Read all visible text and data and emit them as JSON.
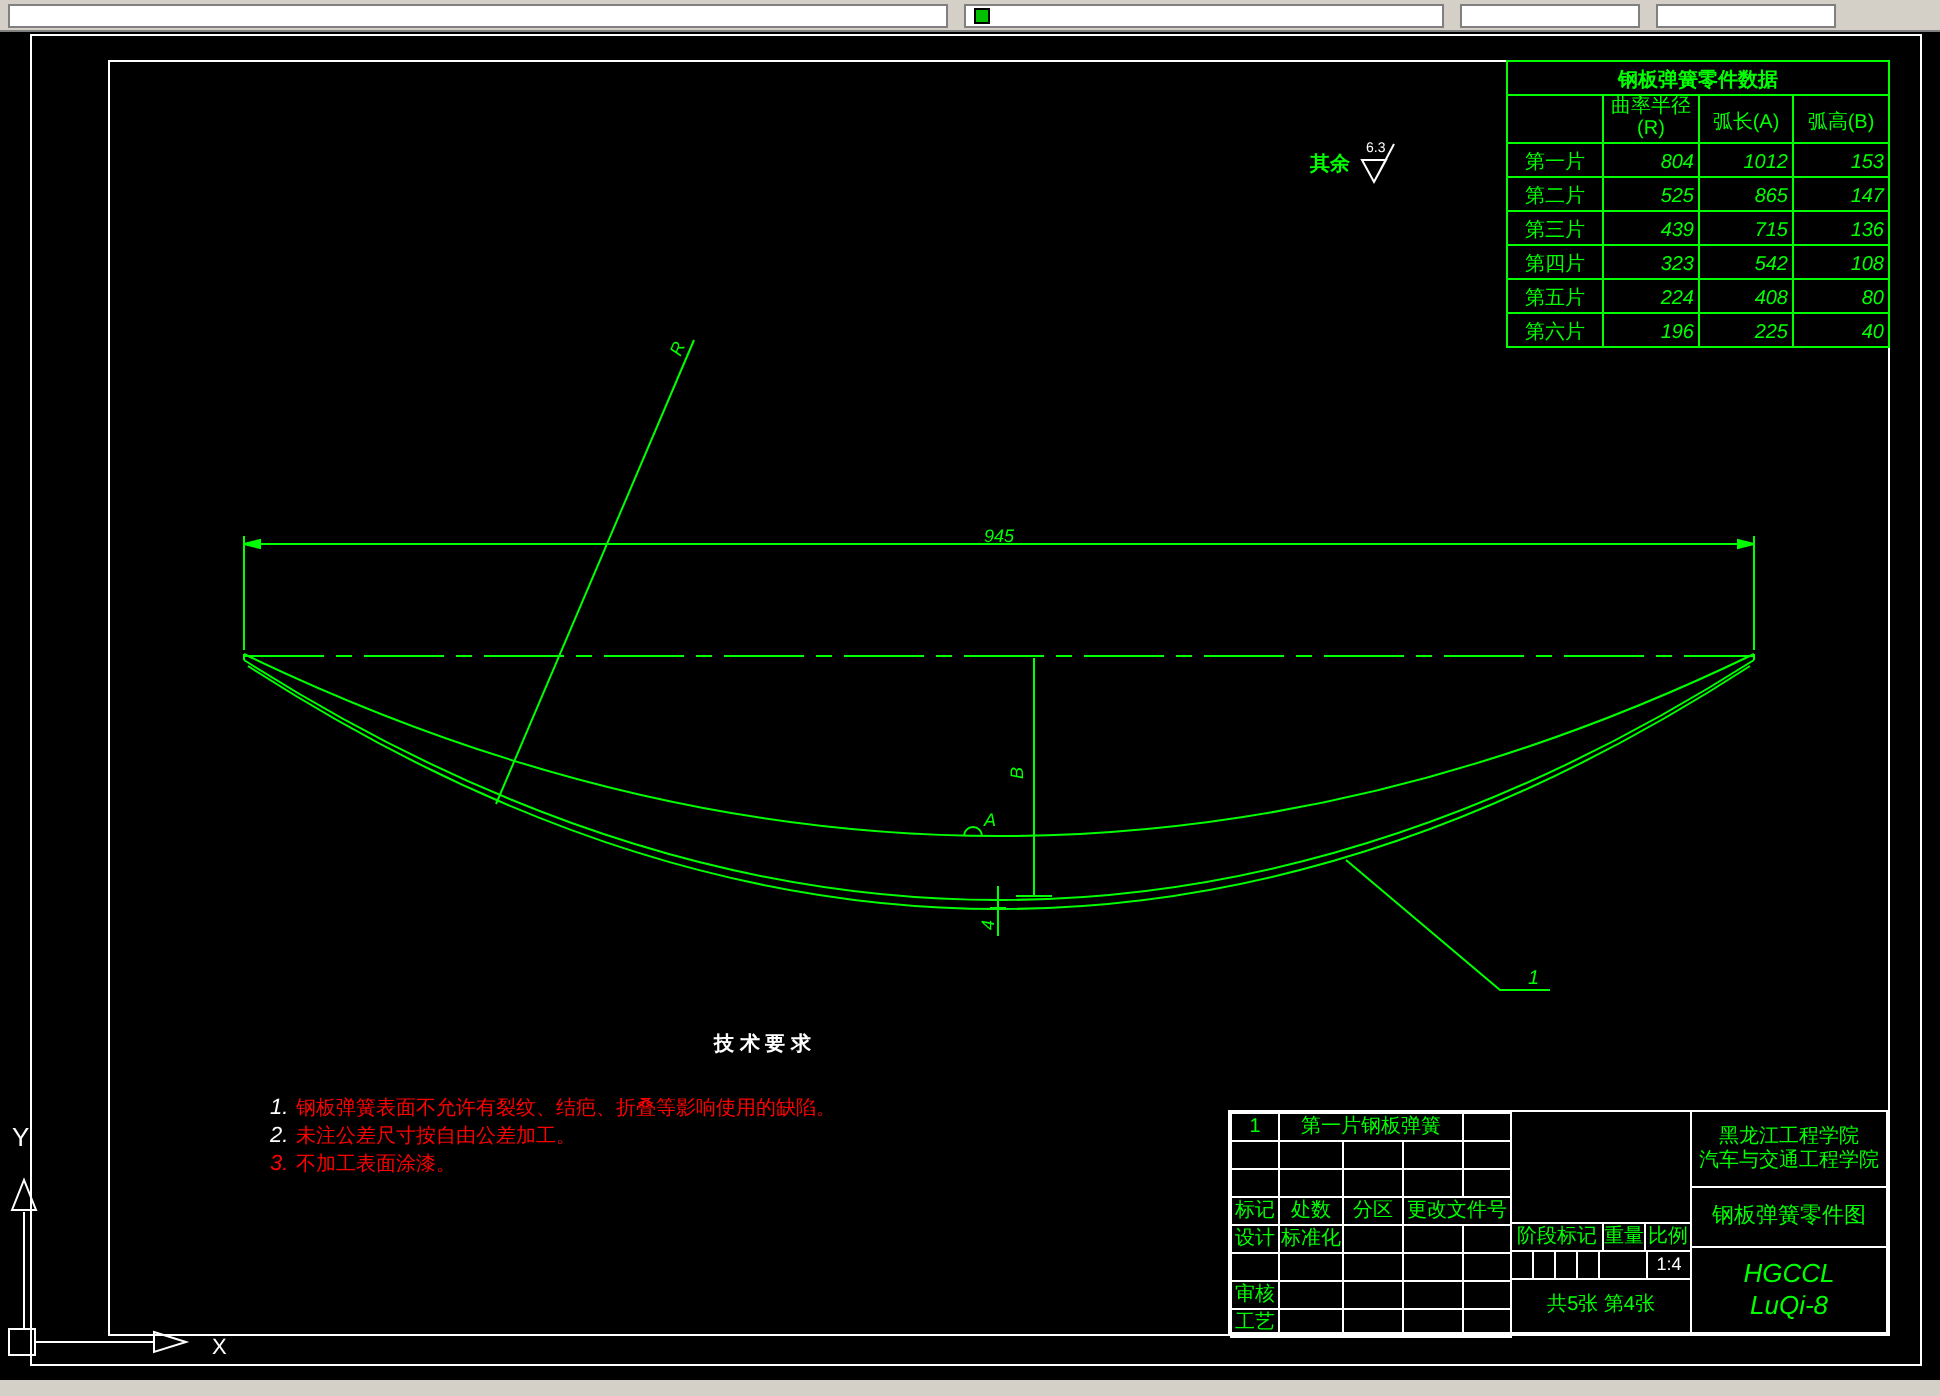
{
  "drawing": {
    "roughness_note": {
      "label": "其余",
      "value": "6.3"
    },
    "dimensions": {
      "span": "945",
      "radius": "R",
      "height": "B",
      "arc": "A",
      "thickness": "4",
      "part_number": "1"
    },
    "leaf_table": {
      "title": "钢板弹簧零件数据",
      "columns": [
        "曲率半径(R)",
        "弧长(A)",
        "弧高(B)"
      ],
      "rows": [
        {
          "name": "第一片",
          "values": [
            "804",
            "1012",
            "153"
          ]
        },
        {
          "name": "第二片",
          "values": [
            "525",
            "865",
            "147"
          ]
        },
        {
          "name": "第三片",
          "values": [
            "439",
            "715",
            "136"
          ]
        },
        {
          "name": "第四片",
          "values": [
            "323",
            "542",
            "108"
          ]
        },
        {
          "name": "第五片",
          "values": [
            "224",
            "408",
            "80"
          ]
        },
        {
          "name": "第六片",
          "values": [
            "196",
            "225",
            "40"
          ]
        }
      ]
    },
    "tech_requirements": {
      "title": "技 术 要 求",
      "items": [
        {
          "number": "1.",
          "text": "钢板弹簧表面不允许有裂纹、结疤、折叠等影响使用的缺陷。",
          "color": "#ffffff"
        },
        {
          "number": "2.",
          "text": "未注公差尺寸按自由公差加工。",
          "color": "#ffffff"
        },
        {
          "number": "3.",
          "text": "不加工表面涂漆。",
          "color": "#ff0000"
        }
      ]
    },
    "title_block": {
      "sheet_item": "1",
      "part_name": "第一片钢板弹簧",
      "revision_labels": [
        "标记",
        "处数",
        "分区",
        "更改文件号"
      ],
      "signature_labels": [
        "设计",
        "标准化"
      ],
      "review_label": "审核",
      "process_label": "工艺",
      "stage_labels": [
        "阶段标记",
        "重量",
        "比例"
      ],
      "scale": "1:4",
      "sheet_count": "共5张 第4张",
      "school": [
        "黑龙江工程学院",
        "汽车与交通工程学院"
      ],
      "drawing_title": "钢板弹簧零件图",
      "drawing_code": [
        "HGCCL",
        "LuQi-8"
      ]
    }
  },
  "ucs": {
    "x": "X",
    "y": "Y"
  }
}
